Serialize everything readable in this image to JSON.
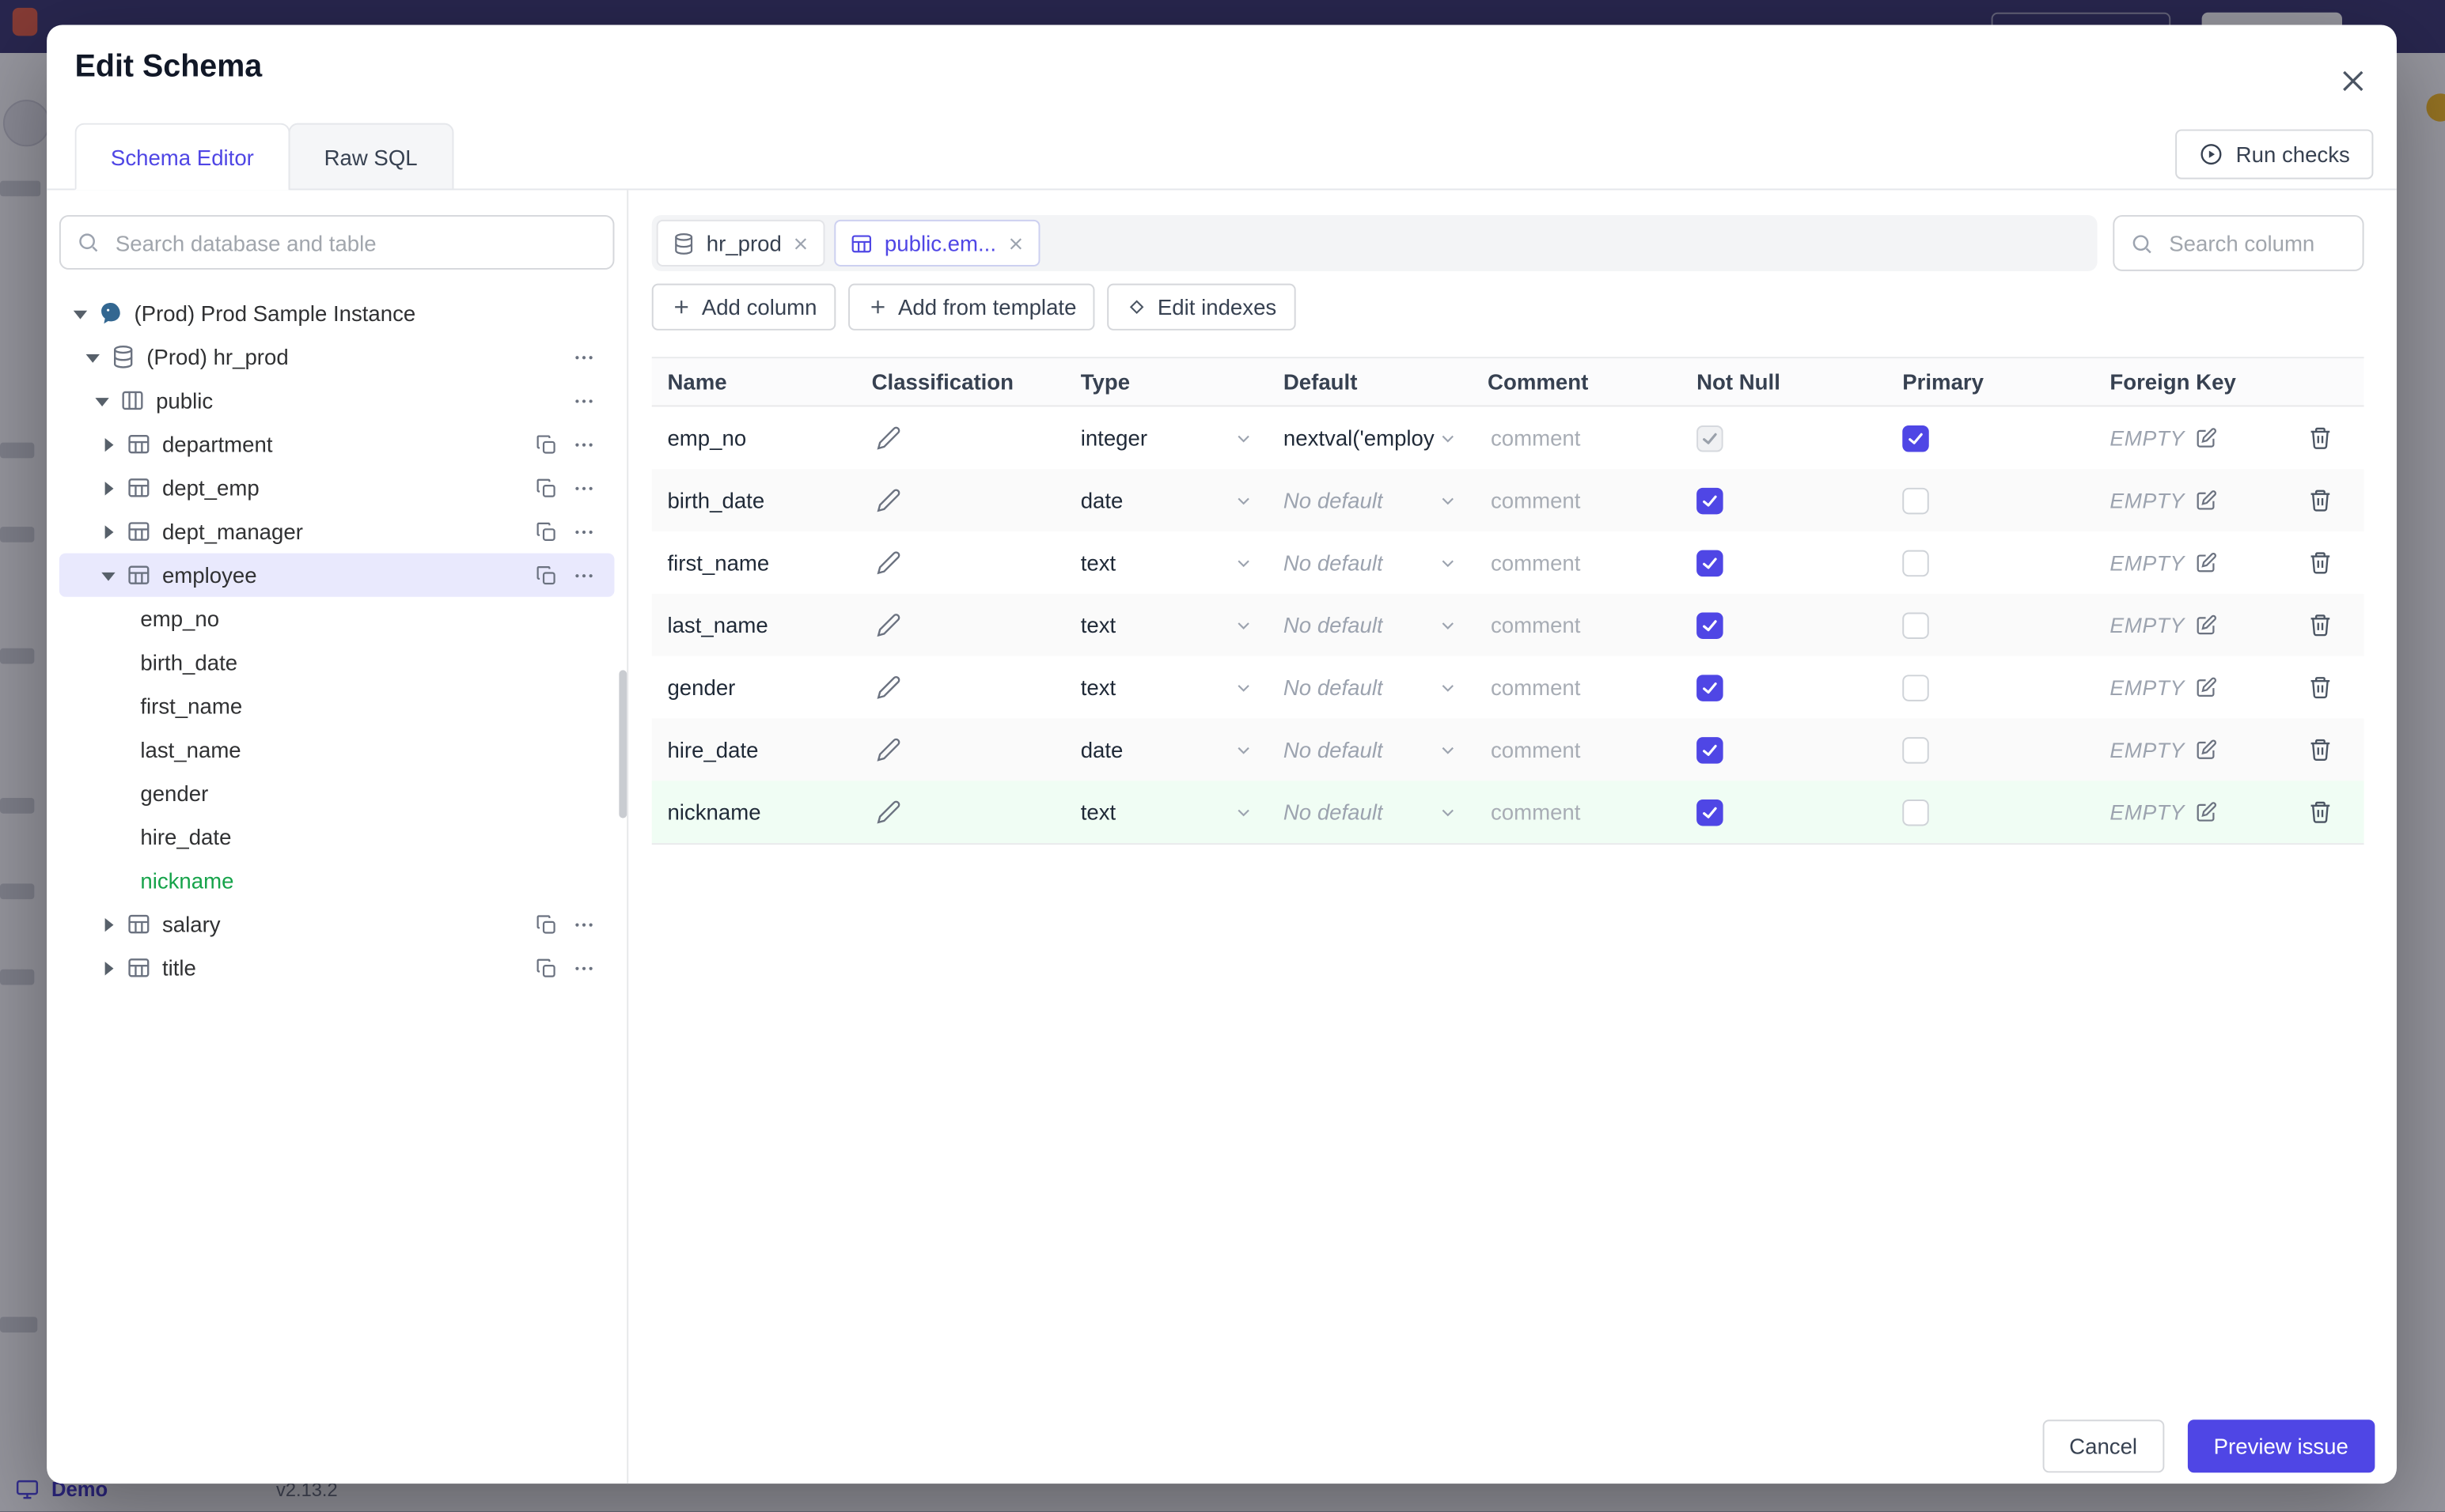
{
  "colors": {
    "primary": "#4f46e5",
    "success_green": "#16a34a",
    "new_row_bg": "#f0fdf4",
    "selected_tree_bg": "#e9e9fd",
    "topbar_bg": "#3b3870"
  },
  "background": {
    "app_name": "Demo",
    "version": "v2.13.2"
  },
  "modal": {
    "title": "Edit Schema",
    "tabs": [
      {
        "label": "Schema Editor"
      },
      {
        "label": "Raw SQL"
      }
    ],
    "run_checks_label": "Run checks",
    "cancel_label": "Cancel",
    "submit_label": "Preview issue"
  },
  "sidebar": {
    "search_placeholder": "Search database and table",
    "tree": [
      {
        "label": "(Prod) Prod Sample Instance"
      },
      {
        "label": "(Prod) hr_prod"
      },
      {
        "label": "public"
      },
      {
        "label": "department"
      },
      {
        "label": "dept_emp"
      },
      {
        "label": "dept_manager"
      },
      {
        "label": "employee"
      },
      {
        "label": "emp_no"
      },
      {
        "label": "birth_date"
      },
      {
        "label": "first_name"
      },
      {
        "label": "last_name"
      },
      {
        "label": "gender"
      },
      {
        "label": "hire_date"
      },
      {
        "label": "nickname"
      },
      {
        "label": "salary"
      },
      {
        "label": "title"
      }
    ]
  },
  "editor": {
    "open_tabs": [
      {
        "label": "hr_prod"
      },
      {
        "label": "public.em..."
      }
    ],
    "column_search_placeholder": "Search column",
    "toolbar": {
      "add_column": "Add column",
      "add_from_template": "Add from template",
      "edit_indexes": "Edit indexes"
    },
    "table": {
      "headers": [
        "Name",
        "Classification",
        "Type",
        "Default",
        "Comment",
        "Not Null",
        "Primary",
        "Foreign Key"
      ],
      "comment_placeholder": "comment",
      "foreign_key_empty": "EMPTY",
      "rows": [
        {
          "name": "emp_no",
          "type": "integer",
          "default": "nextval('employ"
        },
        {
          "name": "birth_date",
          "type": "date",
          "default": "No default"
        },
        {
          "name": "first_name",
          "type": "text",
          "default": "No default"
        },
        {
          "name": "last_name",
          "type": "text",
          "default": "No default"
        },
        {
          "name": "gender",
          "type": "text",
          "default": "No default"
        },
        {
          "name": "hire_date",
          "type": "date",
          "default": "No default"
        },
        {
          "name": "nickname",
          "type": "text",
          "default": "No default"
        }
      ]
    }
  }
}
